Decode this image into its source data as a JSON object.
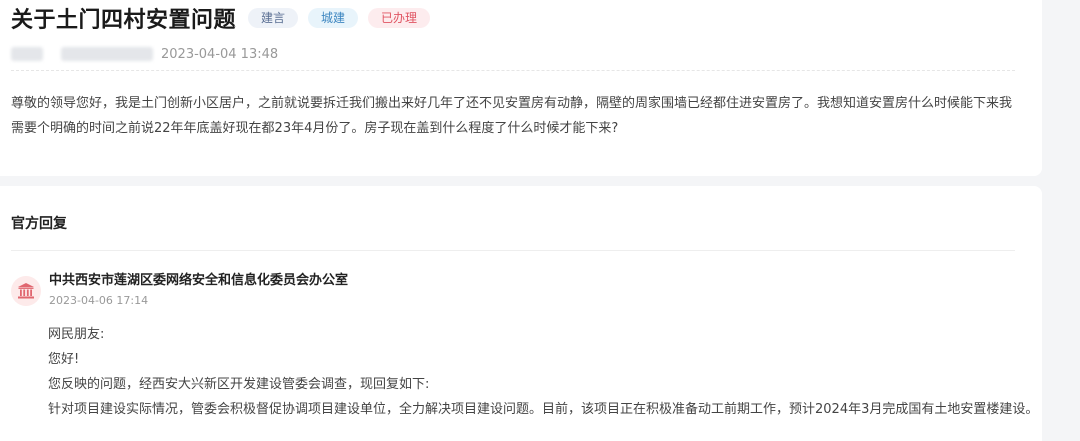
{
  "question": {
    "title": "关于土门四村安置问题",
    "tags": [
      "建言",
      "城建",
      "已办理"
    ],
    "date": "2023-04-04 13:48",
    "body": "尊敬的领导您好，我是土门创新小区居户，之前就说要拆迁我们搬出来好几年了还不见安置房有动静，隔壁的周家围墙已经都住进安置房了。我想知道安置房什么时候能下来我需要个明确的时间之前说22年年底盖好现在都23年4月份了。房子现在盖到什么程度了什么时候才能下来?"
  },
  "reply": {
    "section_title": "官方回复",
    "org": "中共西安市莲湖区委网络安全和信息化委员会办公室",
    "date": "2023-04-06 17:14",
    "lines": [
      "网民朋友:",
      "您好!",
      "您反映的问题，经西安大兴新区开发建设管委会调查，现回复如下:",
      "针对项目建设实际情况，管委会积极督促协调项目建设单位，全力解决项目建设问题。目前，该项目正在积极准备动工前期工作，预计2024年3月完成国有土地安置楼建设。"
    ]
  },
  "icons": {
    "avatar": "government-building-icon"
  },
  "colors": {
    "tag_red": "#e05563",
    "tag_cyan": "#3d86c0",
    "tag_blue": "#5a6f93"
  }
}
